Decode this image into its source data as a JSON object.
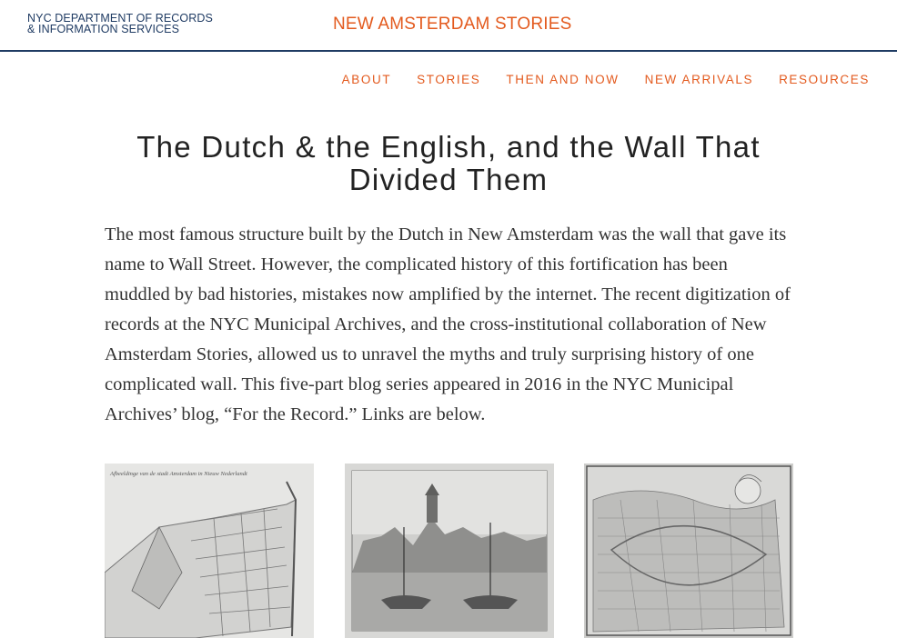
{
  "header": {
    "dept_line1": "NYC DEPARTMENT OF RECORDS",
    "dept_line2": "& INFORMATION SERVICES",
    "site_title": "NEW AMSTERDAM STORIES"
  },
  "nav": [
    "ABOUT",
    "STORIES",
    "THEN AND NOW",
    "NEW ARRIVALS",
    "RESOURCES"
  ],
  "article": {
    "title": "The Dutch & the English, and the Wall That Divided Them",
    "intro": "The most famous structure built by the Dutch in New Amsterdam was the wall that gave its name to Wall Street. However, the complicated history of this fortification has been muddled by bad histories, mistakes now amplified by the internet. The recent digitization of records at the NYC Municipal Archives, and the cross-institutional collaboration of New Amsterdam Stories, allowed us to unravel the myths and truly surprising history of one complicated wall. This five-part blog series appeared in 2016 in the NYC Municipal Archives’ blog, “For the Record.” Links are below."
  },
  "images": {
    "map_caption": "Afbeeldinge van de stadt Amsterdam in Nieuw Nederlandt"
  },
  "colors": {
    "accent": "#e35a1e",
    "navy": "#1f3b63",
    "text": "#333333"
  }
}
